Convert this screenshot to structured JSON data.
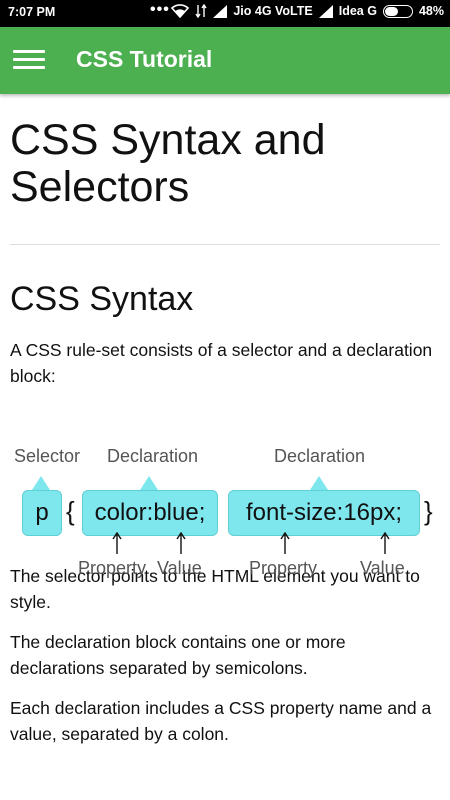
{
  "status_bar": {
    "time": "7:07 PM",
    "carrier1": "Jio 4G VoLTE",
    "carrier2": "Idea G",
    "battery": "48%",
    "battery_level": 0.48
  },
  "app_bar": {
    "title": "CSS Tutorial",
    "menu_icon": "hamburger-menu-icon"
  },
  "page": {
    "title": "CSS Syntax and Selectors",
    "section_title": "CSS Syntax",
    "intro": "A CSS rule-set consists of a selector and a declaration block:",
    "diagram": {
      "selector_label": "Selector",
      "declaration_label_1": "Declaration",
      "declaration_label_2": "Declaration",
      "selector": "p",
      "open_brace": "{",
      "close_brace": "}",
      "declaration_1": "color:blue;",
      "declaration_2": "font-size:16px;",
      "property_label_1": "Property",
      "value_label_1": "Value",
      "property_label_2": "Property",
      "value_label_2": "Value",
      "box_color": "#7ee7ee"
    },
    "paragraphs": [
      "The selector points to the HTML element you want to style.",
      "The declaration block contains one or more declarations separated by semicolons.",
      "Each declaration includes a CSS property name and a value, separated by a colon."
    ]
  },
  "colors": {
    "app_bar": "#4caf50",
    "status_bar": "#000000"
  }
}
